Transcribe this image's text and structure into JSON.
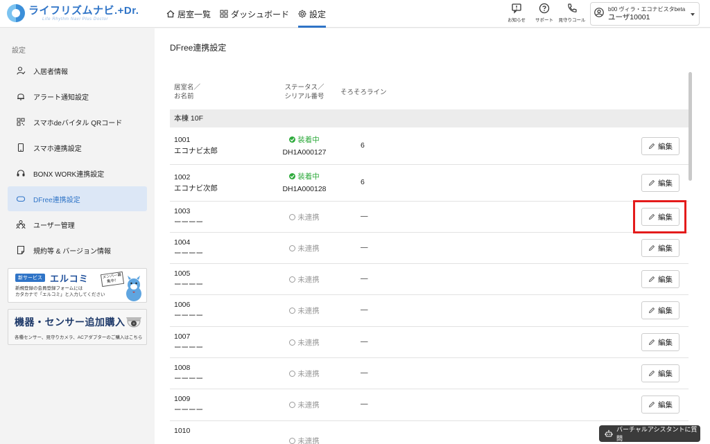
{
  "header": {
    "logo_title": "ライフリズムナビ.+Dr.",
    "logo_sub": "Life Rhythm Navi Plus Doctor",
    "nav": [
      {
        "label": "居室一覧",
        "icon": "home-icon"
      },
      {
        "label": "ダッシュボード",
        "icon": "dashboard-icon"
      },
      {
        "label": "設定",
        "icon": "gear-icon",
        "active": true
      }
    ],
    "icons": [
      {
        "label": "お知らせ",
        "icon": "notice-icon"
      },
      {
        "label": "サポート",
        "icon": "help-icon"
      },
      {
        "label": "見守りコール",
        "icon": "phone-icon"
      }
    ],
    "user": {
      "facility": "b00 ヴィラ・エコナビスタbeta",
      "name": "ユーザ10001"
    }
  },
  "sidebar": {
    "heading": "設定",
    "items": [
      {
        "label": "入居者情報",
        "icon": "resident-icon"
      },
      {
        "label": "アラート通知設定",
        "icon": "bell-icon"
      },
      {
        "label": "スマホdeバイタル QRコード",
        "icon": "qr-icon"
      },
      {
        "label": "スマホ連携設定",
        "icon": "smartphone-icon"
      },
      {
        "label": "BONX WORK連携設定",
        "icon": "headset-icon"
      },
      {
        "label": "DFree連携設定",
        "icon": "dfree-icon",
        "active": true
      },
      {
        "label": "ユーザー管理",
        "icon": "users-icon"
      },
      {
        "label": "規約等 & バージョン情報",
        "icon": "document-icon"
      }
    ],
    "banner1": {
      "badge": "新サービス",
      "brand": "エルコミ",
      "desc1": "新規登録の会員登録フォームには",
      "desc2": "カタカナで「エルコミ」と入力してください",
      "sign": "メンバー募集中！"
    },
    "banner2": {
      "title": "機器・センサー追加購入",
      "desc": "各種センサー、見守りカメラ、ACアダプターのご購入はこちら"
    }
  },
  "main": {
    "title": "DFree連携設定",
    "columns": {
      "room_line1": "居室名／",
      "room_line2": "お名前",
      "status_line1": "ステータス／",
      "status_line2": "シリアル番号",
      "line": "そろそろライン"
    },
    "group": "本棟 10F",
    "edit_label": "編集",
    "rows": [
      {
        "room": "1001",
        "name": "エコナビ太郎",
        "status": "装着中",
        "serial": "DH1A000127",
        "line": "6"
      },
      {
        "room": "1002",
        "name": "エコナビ次郎",
        "status": "装着中",
        "serial": "DH1A000128",
        "line": "6"
      },
      {
        "room": "1003",
        "name": "ーーーー",
        "status": "未連携",
        "serial": "",
        "line": "—"
      },
      {
        "room": "1004",
        "name": "ーーーー",
        "status": "未連携",
        "serial": "",
        "line": "—"
      },
      {
        "room": "1005",
        "name": "ーーーー",
        "status": "未連携",
        "serial": "",
        "line": "—"
      },
      {
        "room": "1006",
        "name": "ーーーー",
        "status": "未連携",
        "serial": "",
        "line": "—"
      },
      {
        "room": "1007",
        "name": "ーーーー",
        "status": "未連携",
        "serial": "",
        "line": "—"
      },
      {
        "room": "1008",
        "name": "ーーーー",
        "status": "未連携",
        "serial": "",
        "line": "—"
      },
      {
        "room": "1009",
        "name": "ーーーー",
        "status": "未連携",
        "serial": "",
        "line": "—"
      },
      {
        "room": "1010",
        "name": "",
        "status": "未連携",
        "serial": "",
        "line": ""
      }
    ]
  },
  "assistant": {
    "label": "バーチャルアシスタントに質問"
  },
  "colors": {
    "accent": "#2f74c7",
    "active_status": "#2eaa3c",
    "highlight": "#e41b1b"
  }
}
